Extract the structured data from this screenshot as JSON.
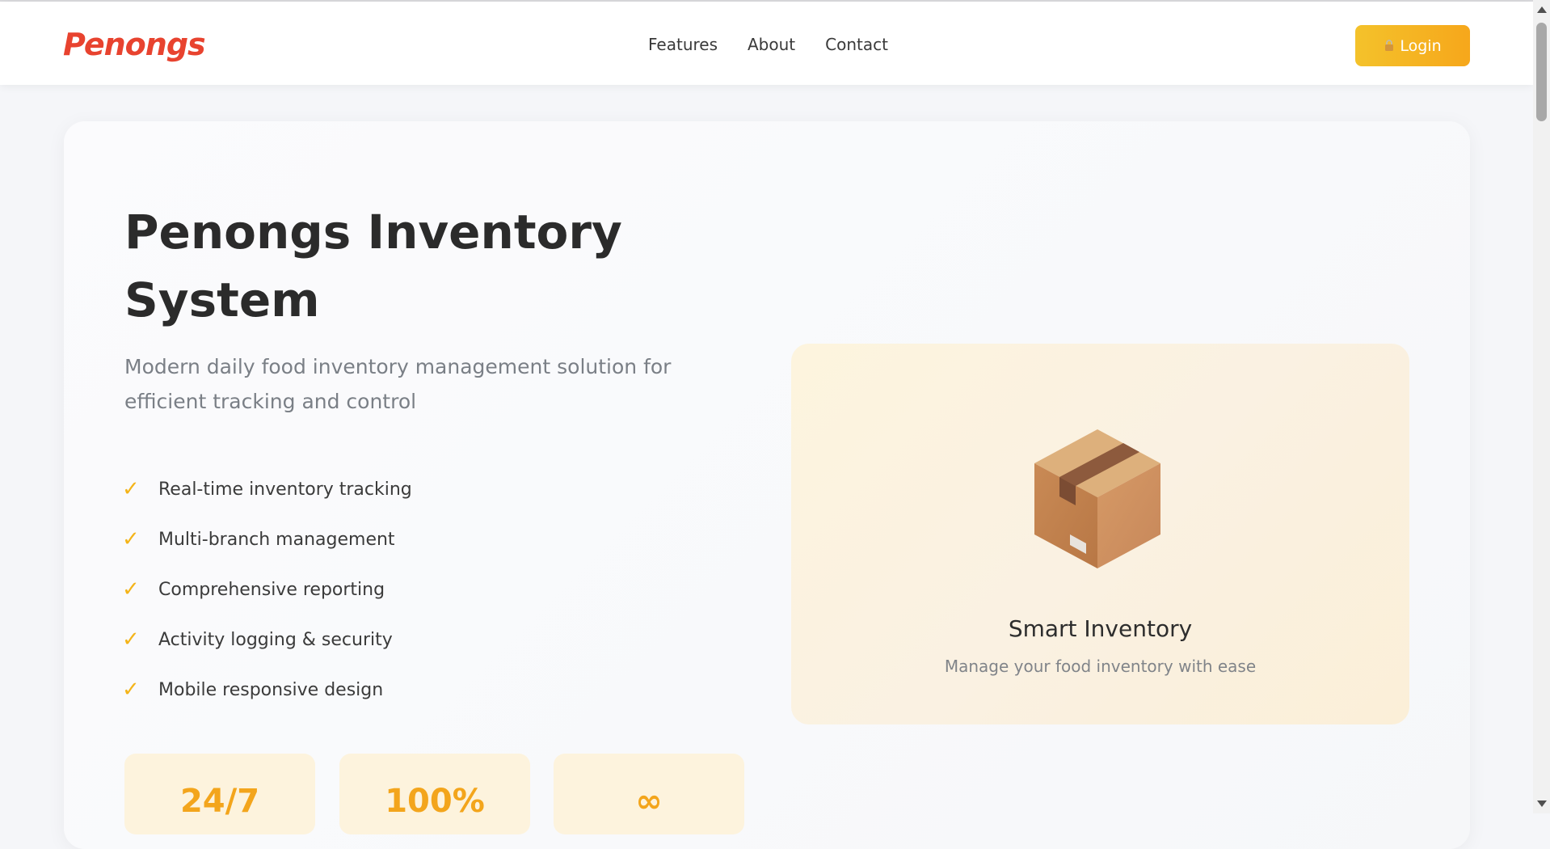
{
  "header": {
    "brand": "Penongs",
    "nav": [
      {
        "label": "Features"
      },
      {
        "label": "About"
      },
      {
        "label": "Contact"
      }
    ],
    "login_label": "Login",
    "login_icon": "lock-icon"
  },
  "hero": {
    "title": "Penongs Inventory System",
    "subtitle": "Modern daily food inventory management solution for efficient tracking and control",
    "features": [
      {
        "label": "Real-time inventory tracking"
      },
      {
        "label": "Multi-branch management"
      },
      {
        "label": "Comprehensive reporting"
      },
      {
        "label": "Activity logging & security"
      },
      {
        "label": "Mobile responsive design"
      }
    ],
    "check_glyph": "✓"
  },
  "showcase": {
    "icon": "box-icon",
    "title": "Smart Inventory",
    "subtitle": "Manage your food inventory with ease"
  },
  "stats": [
    {
      "value": "24/7"
    },
    {
      "value": "100%"
    },
    {
      "value": "∞"
    }
  ],
  "colors": {
    "brand": "#e8432f",
    "accent": "#f4b41a",
    "login_gradient_start": "#f4c22b",
    "login_gradient_end": "#f6a71b",
    "stat_value": "#f3a51c"
  }
}
